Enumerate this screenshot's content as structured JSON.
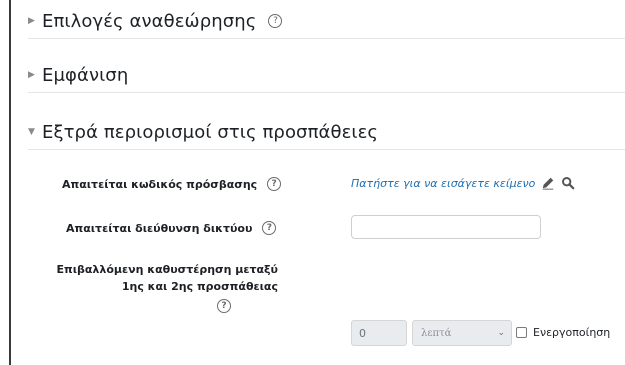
{
  "sections": [
    {
      "title": "Επιλογές αναθεώρησης",
      "expanded": false,
      "help_icon": "question-circle-icon"
    },
    {
      "title": "Εμφάνιση",
      "expanded": false
    },
    {
      "title": "Εξτρά περιορισμοί στις προσπάθειες",
      "expanded": true
    }
  ],
  "fields": {
    "password": {
      "label": "Απαιτείται κωδικός πρόσβασης",
      "link_text": "Πατήστε για να εισάγετε κείμενο",
      "edit_icon": "pencil-icon",
      "reveal_icon": "magnifier-icon"
    },
    "network": {
      "label": "Απαιτείται διεύθυνση δικτύου",
      "value": ""
    },
    "delay": {
      "label_line1": "Επιβαλλόμενη καθυστέρηση μεταξύ",
      "label_line2": "1ης και 2ης προσπάθειας",
      "number": "0",
      "unit": "λεπτά",
      "enable_label": "Ενεργοποίηση",
      "enabled": false
    }
  },
  "help_glyph": "?",
  "colors": {
    "link": "#1f6fb2",
    "disabled_bg": "#e9ecef"
  }
}
